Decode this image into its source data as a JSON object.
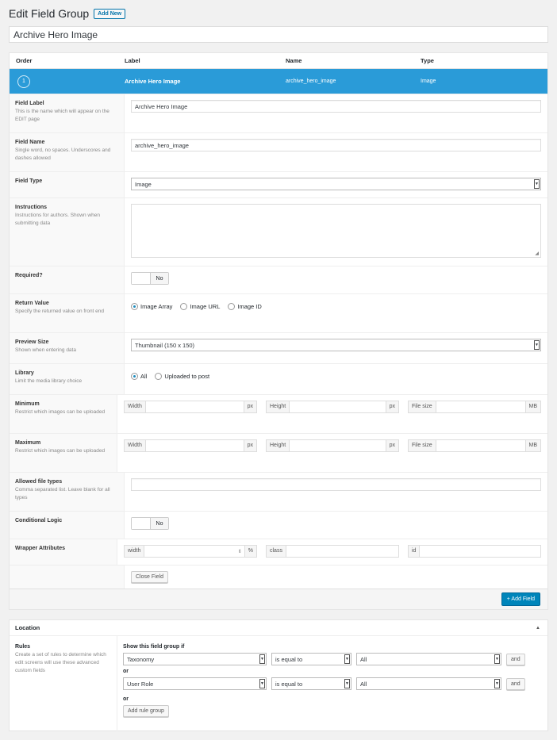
{
  "header": {
    "title": "Edit Field Group",
    "add_new": "Add New"
  },
  "field_group_title": "Archive Hero Image",
  "field_list": {
    "columns": [
      "Order",
      "Label",
      "Name",
      "Type"
    ],
    "row": {
      "order": "1",
      "label": "Archive Hero Image",
      "name": "archive_hero_image",
      "type": "Image"
    }
  },
  "settings": {
    "field_label": {
      "title": "Field Label",
      "desc": "This is the name which will appear on the EDIT page",
      "value": "Archive Hero Image"
    },
    "field_name": {
      "title": "Field Name",
      "desc": "Single word, no spaces. Underscores and dashes allowed",
      "value": "archive_hero_image"
    },
    "field_type": {
      "title": "Field Type",
      "value": "Image"
    },
    "instructions": {
      "title": "Instructions",
      "desc": "Instructions for authors. Shown when submitting data",
      "value": ""
    },
    "required": {
      "title": "Required?",
      "value": "No"
    },
    "return_value": {
      "title": "Return Value",
      "desc": "Specify the returned value on front end",
      "options": [
        "Image Array",
        "Image URL",
        "Image ID"
      ],
      "selected": "Image Array"
    },
    "preview_size": {
      "title": "Preview Size",
      "desc": "Shown when entering data",
      "value": "Thumbnail (150 x 150)"
    },
    "library": {
      "title": "Library",
      "desc": "Limit the media library choice",
      "options": [
        "All",
        "Uploaded to post"
      ],
      "selected": "All"
    },
    "minimum": {
      "title": "Minimum",
      "desc": "Restrict which images can be uploaded",
      "width": "Width",
      "height": "Height",
      "file_size": "File size",
      "px": "px",
      "mb": "MB"
    },
    "maximum": {
      "title": "Maximum",
      "desc": "Restrict which images can be uploaded",
      "width": "Width",
      "height": "Height",
      "file_size": "File size",
      "px": "px",
      "mb": "MB"
    },
    "allowed_types": {
      "title": "Allowed file types",
      "desc": "Comma separated list. Leave blank for all types",
      "value": ""
    },
    "conditional_logic": {
      "title": "Conditional Logic",
      "value": "No"
    },
    "wrapper": {
      "title": "Wrapper Attributes",
      "width": "width",
      "percent": "%",
      "class": "class",
      "id": "id"
    },
    "close_field": "Close Field"
  },
  "add_field": "+ Add Field",
  "location": {
    "title": "Location",
    "rules_title": "Rules",
    "rules_desc": "Create a set of rules to determine which edit screens will use these advanced custom fields",
    "show_if": "Show this field group if",
    "rules": [
      {
        "param": "Taxonomy",
        "operator": "is equal to",
        "value": "All",
        "and": "and"
      },
      {
        "param": "User Role",
        "operator": "is equal to",
        "value": "All",
        "and": "and"
      }
    ],
    "or_label": "or",
    "add_rule_group": "Add rule group"
  }
}
